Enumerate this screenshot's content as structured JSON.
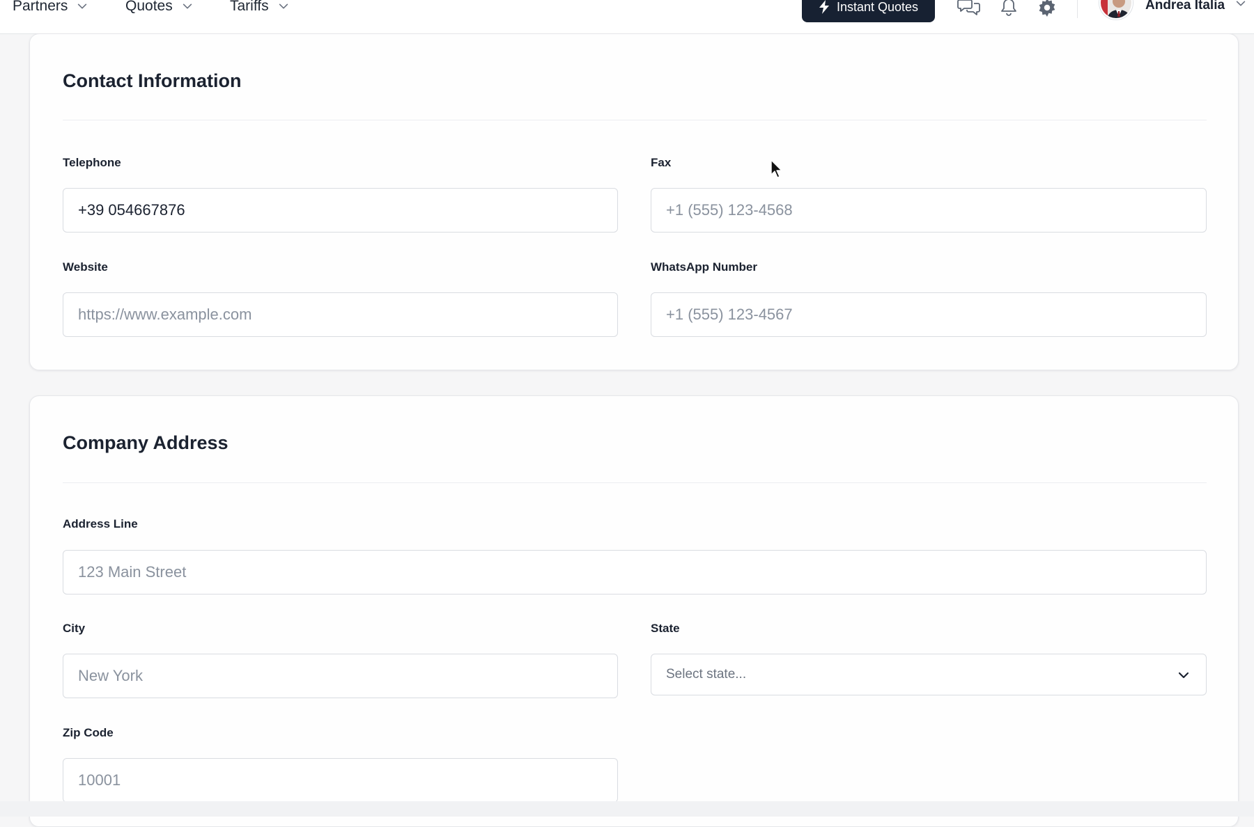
{
  "nav": {
    "items": [
      {
        "label": "Partners"
      },
      {
        "label": "Quotes"
      },
      {
        "label": "Tariffs"
      }
    ],
    "instant_quotes_label": "Instant Quotes",
    "icons": [
      "chat-icon",
      "bell-icon",
      "gear-icon"
    ],
    "user_name": "Andrea Italia"
  },
  "contact": {
    "title": "Contact Information",
    "telephone": {
      "label": "Telephone",
      "value": "+39 054667876",
      "placeholder": ""
    },
    "fax": {
      "label": "Fax",
      "value": "",
      "placeholder": "+1 (555) 123-4568"
    },
    "website": {
      "label": "Website",
      "value": "",
      "placeholder": "https://www.example.com"
    },
    "whatsapp": {
      "label": "WhatsApp Number",
      "value": "",
      "placeholder": "+1 (555) 123-4567"
    }
  },
  "address": {
    "title": "Company Address",
    "address_line": {
      "label": "Address Line",
      "value": "",
      "placeholder": "123 Main Street"
    },
    "city": {
      "label": "City",
      "value": "",
      "placeholder": "New York"
    },
    "state": {
      "label": "State",
      "selected": "Select state..."
    },
    "zip": {
      "label": "Zip Code",
      "value": "",
      "placeholder": "10001"
    }
  },
  "colors": {
    "primary_button_bg": "#172132",
    "text": "#1b2230",
    "placeholder": "#8a929e",
    "border": "#d9dce1"
  }
}
